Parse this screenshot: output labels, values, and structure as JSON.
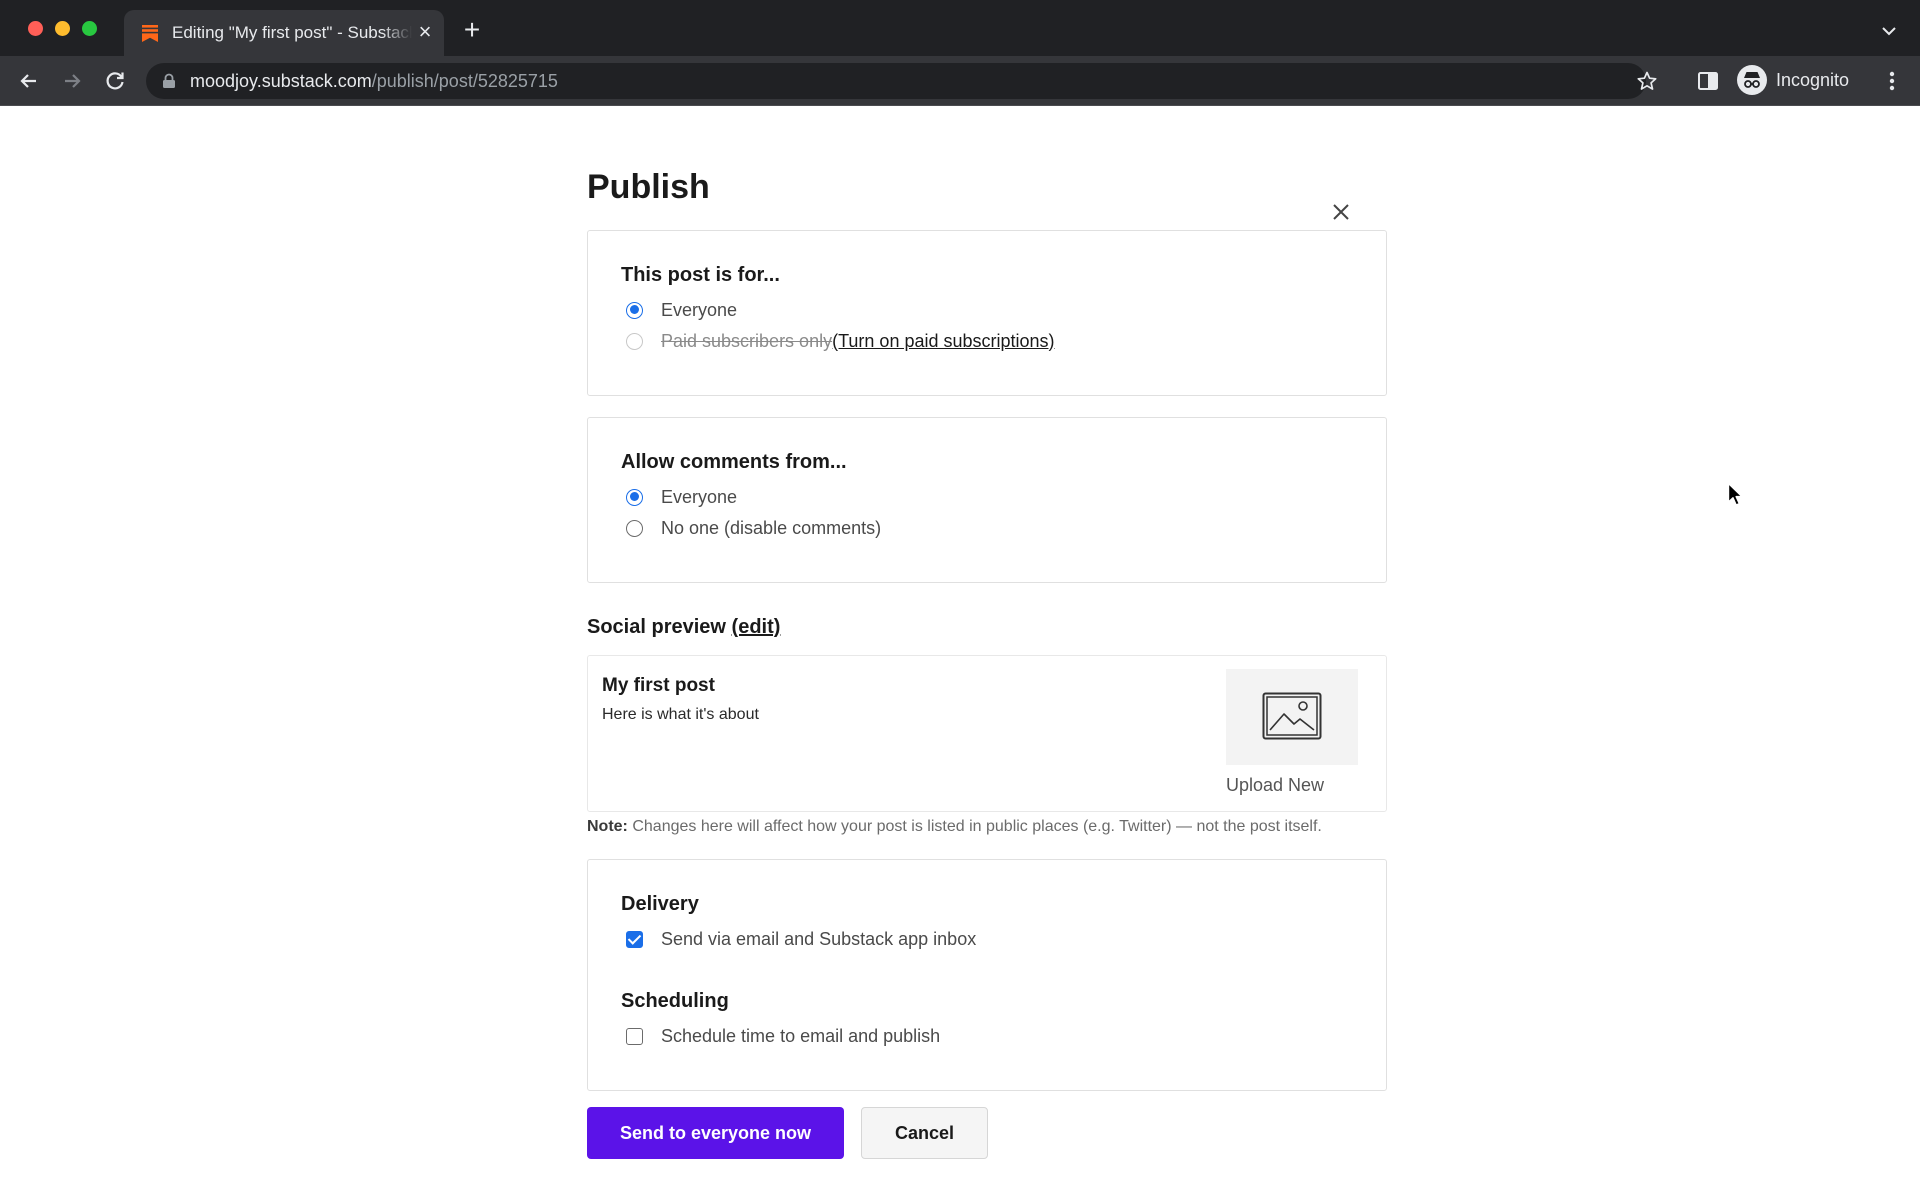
{
  "browser": {
    "tab_title": "Editing \"My first post\" - Substack",
    "url_host": "moodjoy.substack.com",
    "url_path": "/publish/post/52825715",
    "profile_label": "Incognito"
  },
  "modal": {
    "title": "Publish",
    "audience": {
      "heading": "This post is for...",
      "option_everyone": "Everyone",
      "option_paid": "Paid subscribers only",
      "option_paid_link": "(Turn on paid subscriptions)",
      "selected": "Everyone"
    },
    "comments": {
      "heading": "Allow comments from...",
      "option_everyone": "Everyone",
      "option_noone": "No one (disable comments)",
      "selected": "Everyone"
    },
    "social": {
      "heading": "Social preview",
      "edit_link": "(edit)",
      "preview_title": "My first post",
      "preview_subtitle": "Here is what it's about",
      "upload_label": "Upload New",
      "note_label": "Note:",
      "note_text": " Changes here will affect how your post is listed in public places (e.g. Twitter) — not the post itself."
    },
    "delivery": {
      "heading": "Delivery",
      "option_email": "Send via email and Substack app inbox",
      "email_checked": true
    },
    "scheduling": {
      "heading": "Scheduling",
      "option_schedule": "Schedule time to email and publish",
      "schedule_checked": false
    },
    "buttons": {
      "primary": "Send to everyone now",
      "cancel": "Cancel"
    }
  },
  "colors": {
    "accent_primary": "#5b13e8",
    "radio_selected": "#1a6ee8",
    "substack_orange": "#ff6719"
  }
}
